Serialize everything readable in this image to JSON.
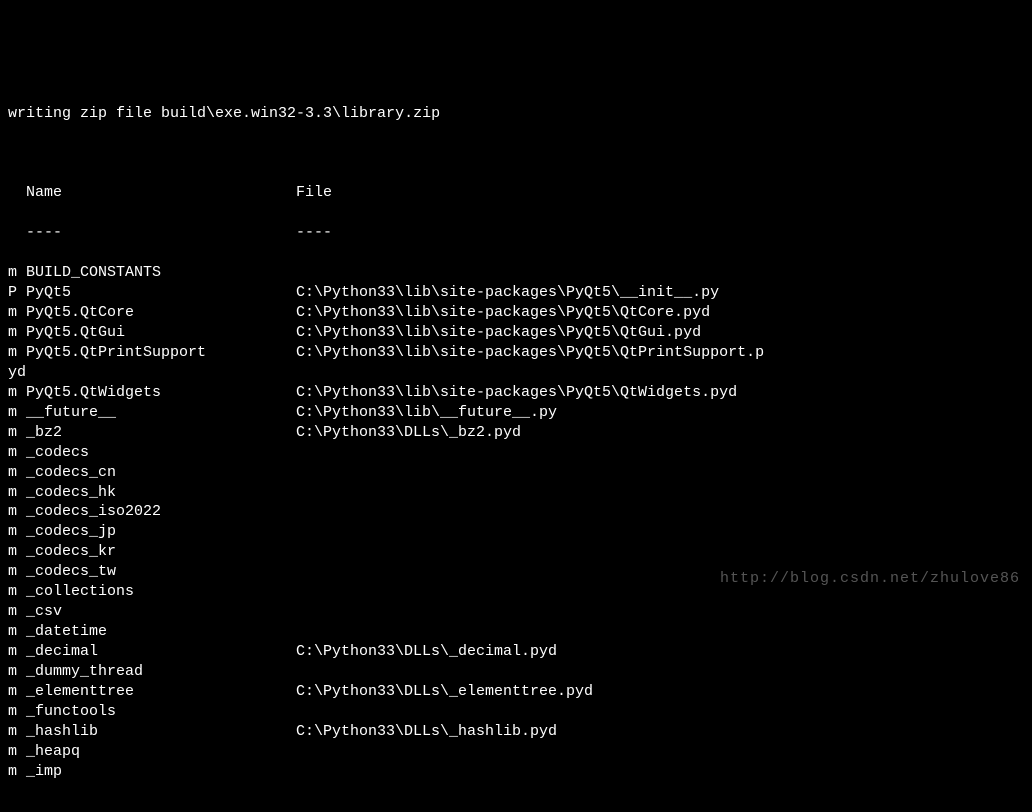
{
  "header": "writing zip file build\\exe.win32-3.3\\library.zip",
  "columns": {
    "name": "Name",
    "file": "File",
    "name_dash": "----",
    "file_dash": "----"
  },
  "rows": [
    {
      "flag": "m",
      "name": "BUILD_CONSTANTS",
      "file": ""
    },
    {
      "flag": "P",
      "name": "PyQt5",
      "file": "C:\\Python33\\lib\\site-packages\\PyQt5\\__init__.py"
    },
    {
      "flag": "m",
      "name": "PyQt5.QtCore",
      "file": "C:\\Python33\\lib\\site-packages\\PyQt5\\QtCore.pyd"
    },
    {
      "flag": "m",
      "name": "PyQt5.QtGui",
      "file": "C:\\Python33\\lib\\site-packages\\PyQt5\\QtGui.pyd"
    },
    {
      "flag": "m",
      "name": "PyQt5.QtPrintSupport",
      "file": "C:\\Python33\\lib\\site-packages\\PyQt5\\QtPrintSupport.p"
    },
    {
      "flag": "",
      "name": "yd",
      "file": "",
      "nowrap": true
    },
    {
      "flag": "m",
      "name": "PyQt5.QtWidgets",
      "file": "C:\\Python33\\lib\\site-packages\\PyQt5\\QtWidgets.pyd"
    },
    {
      "flag": "m",
      "name": "__future__",
      "file": "C:\\Python33\\lib\\__future__.py"
    },
    {
      "flag": "m",
      "name": "_bz2",
      "file": "C:\\Python33\\DLLs\\_bz2.pyd"
    },
    {
      "flag": "m",
      "name": "_codecs",
      "file": ""
    },
    {
      "flag": "m",
      "name": "_codecs_cn",
      "file": ""
    },
    {
      "flag": "m",
      "name": "_codecs_hk",
      "file": ""
    },
    {
      "flag": "m",
      "name": "_codecs_iso2022",
      "file": ""
    },
    {
      "flag": "m",
      "name": "_codecs_jp",
      "file": ""
    },
    {
      "flag": "m",
      "name": "_codecs_kr",
      "file": ""
    },
    {
      "flag": "m",
      "name": "_codecs_tw",
      "file": ""
    },
    {
      "flag": "m",
      "name": "_collections",
      "file": ""
    },
    {
      "flag": "m",
      "name": "_csv",
      "file": ""
    },
    {
      "flag": "m",
      "name": "_datetime",
      "file": ""
    },
    {
      "flag": "m",
      "name": "_decimal",
      "file": "C:\\Python33\\DLLs\\_decimal.pyd"
    },
    {
      "flag": "m",
      "name": "_dummy_thread",
      "file": ""
    },
    {
      "flag": "m",
      "name": "_elementtree",
      "file": "C:\\Python33\\DLLs\\_elementtree.pyd"
    },
    {
      "flag": "m",
      "name": "_functools",
      "file": ""
    },
    {
      "flag": "m",
      "name": "_hashlib",
      "file": "C:\\Python33\\DLLs\\_hashlib.pyd"
    },
    {
      "flag": "m",
      "name": "_heapq",
      "file": ""
    },
    {
      "flag": "m",
      "name": "_imp",
      "file": ""
    }
  ],
  "watermark": "http://blog.csdn.net/zhulove86"
}
